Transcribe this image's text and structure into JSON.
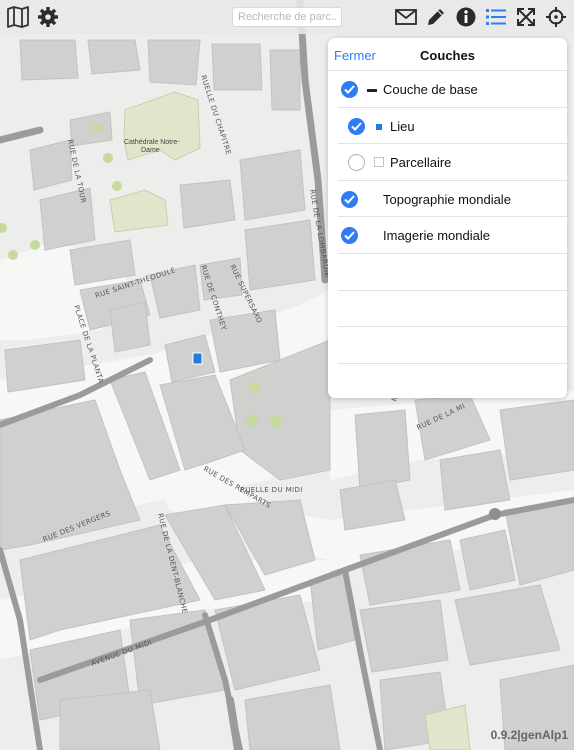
{
  "toolbar": {
    "icons": [
      "map-icon",
      "gear-icon",
      "mail-icon",
      "pencil-icon",
      "info-icon",
      "list-icon",
      "expand-icon",
      "crosshair-icon"
    ],
    "search_placeholder": "Recherche de parc...",
    "search_value": "",
    "active_icon": "list-icon",
    "accent_color": "#2e7cf6"
  },
  "layers_panel": {
    "close_label": "Fermer",
    "title": "Couches",
    "layers": [
      {
        "label": "Couche de base",
        "checked": true
      },
      {
        "label": "Lieu",
        "checked": true
      },
      {
        "label": "Parcellaire",
        "checked": false
      },
      {
        "label": "Topographie mondiale",
        "checked": true
      },
      {
        "label": "Imagerie mondiale",
        "checked": true
      }
    ]
  },
  "map": {
    "street_labels": [
      "RUE DE LA TOUR",
      "RUE SAINT-THÉODULE",
      "PLACE DE LA PLANTA",
      "RUELLE DU CHAPITRE",
      "RUE DE CONTHEY",
      "RUE SUPERSAXO",
      "RUE DE LA LOMBARDIE",
      "RUE DES REMPARTS",
      "RUELLE DU MIDI",
      "RUE DES VERGERS",
      "RUE DE LA DENT-BLANCHE",
      "AVENUE DU MIDI",
      "RUE DU RHÔNE",
      "RUE DE LA MI"
    ],
    "poi_label_lines": [
      "Cathédrale Notre-",
      "Dame"
    ]
  },
  "version": "0.9.2|genAlp1"
}
